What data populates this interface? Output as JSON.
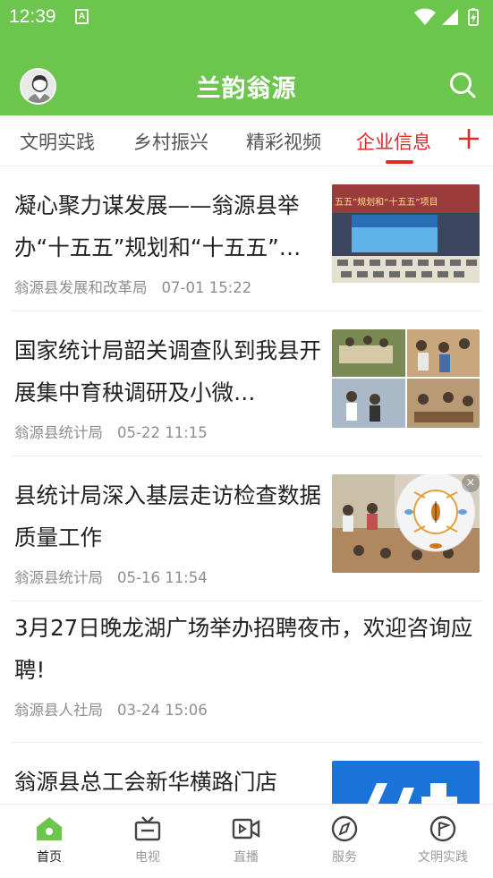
{
  "status_bar": {
    "time": "12:39",
    "app_indicator": "A"
  },
  "app_bar": {
    "title": "兰韵翁源",
    "avatar_icon": "user-avatar-icon",
    "search_icon": "search-icon"
  },
  "colors": {
    "brand_green": "#6cc54c",
    "accent_red": "#e02a2a",
    "meta_gray": "#8e8e8e"
  },
  "tabs": [
    {
      "label": "文明实践",
      "active": false
    },
    {
      "label": "乡村振兴",
      "active": false
    },
    {
      "label": "精彩视频",
      "active": false
    },
    {
      "label": "企业信息",
      "active": true
    }
  ],
  "tab_add_icon": "plus-icon",
  "news": [
    {
      "title": "凝心聚力谋发展——翁源县举办“十五五”规划和“十五五”…",
      "source": "翁源县发展和改革局",
      "time": "07-01 15:22",
      "thumb": "meeting-hall-photo",
      "thumb_caption": "五五”规划和“十五五”项目"
    },
    {
      "title": "国家统计局韶关调查队到我县开展集中育秧调研及小微…",
      "source": "翁源县统计局",
      "time": "05-22 11:15",
      "thumb": "photo-collage"
    },
    {
      "title": "县统计局深入基层走访检查数据质量工作",
      "source": "翁源县统计局",
      "time": "05-16 11:54",
      "thumb": "photo-with-ad-overlay",
      "ad_close": "×"
    },
    {
      "title": "3月27日晚龙湖广场举办招聘夜市，欢迎咨询应聘!",
      "source": "翁源县人社局",
      "time": "03-24 15:06"
    },
    {
      "title": "翁源县总工会新华横路门店",
      "source": "",
      "time": "",
      "thumb": "poster-photo"
    }
  ],
  "bottom_nav": [
    {
      "label": "首页",
      "icon": "home-icon",
      "active": true
    },
    {
      "label": "电视",
      "icon": "tv-icon",
      "active": false
    },
    {
      "label": "直播",
      "icon": "live-video-icon",
      "active": false
    },
    {
      "label": "服务",
      "icon": "compass-icon",
      "active": false
    },
    {
      "label": "文明实践",
      "icon": "flag-badge-icon",
      "active": false
    }
  ]
}
